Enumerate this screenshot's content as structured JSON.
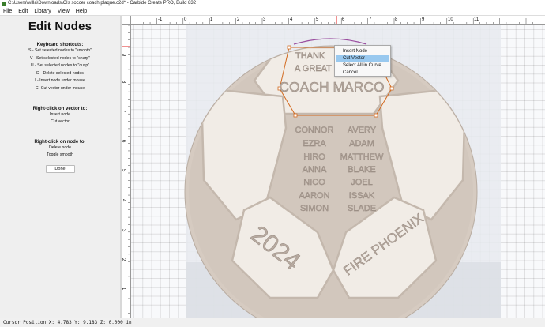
{
  "window": {
    "title": "C:\\Users\\willa\\Downloads\\CIs soccer coach plaque.c2d* - Carbide Create PRO, Build 832"
  },
  "menu": [
    "File",
    "Edit",
    "Library",
    "View",
    "Help"
  ],
  "panel": {
    "title": "Edit Nodes",
    "keyboard_heading": "Keyboard shortcuts:",
    "keyboard_lines": [
      "S - Set selected nodes to \"smooth\"",
      "V - Set selected nodes to \"sharp\"",
      "U - Set selected nodes to \"cusp\"",
      "D - Delete selected nodes",
      "I - Insert node under mouse",
      "C- Cut vector under mouse"
    ],
    "vector_heading": "Right-click on vector to:",
    "vector_lines": [
      "Insert node",
      "Cut vector"
    ],
    "node_heading": "Right-click on node to:",
    "node_lines": [
      "Delete node",
      "Toggle smooth"
    ],
    "done_label": "Done"
  },
  "ruler_top": {
    "labels": [
      "-1",
      "0",
      "1",
      "2",
      "3",
      "4",
      "5",
      "6",
      "7",
      "8",
      "9",
      "10",
      "11"
    ]
  },
  "ruler_left": {
    "labels": [
      "9",
      "8",
      "7",
      "6",
      "5",
      "4",
      "3",
      "2",
      "1"
    ]
  },
  "design": {
    "line1": "THANK",
    "line2": "A GREAT",
    "coach": "COACH MARCO",
    "names_left": [
      "CONNOR",
      "EZRA",
      "HIRO",
      "ANNA",
      "NICO",
      "AARON",
      "SIMON"
    ],
    "names_right": [
      "AVERY",
      "ADAM",
      "MATTHEW",
      "BLAKE",
      "JOEL",
      "ISSAK",
      "SLADE"
    ],
    "year": "2024",
    "team": "FIRE PHOENIX"
  },
  "context_menu": {
    "items": [
      "Insert Node",
      "Cut Vector",
      "Select All in Curve",
      "Cancel"
    ],
    "selected_index": 1
  },
  "status": {
    "text": "Cursor Position X: 4.783 Y: 9.183 Z: 0.000 in"
  },
  "colors": {
    "accent_red": "#e02020",
    "selection_blue": "#99c9ef",
    "node_orange": "#d2691e",
    "wood": "#d2c7bd",
    "panel_face": "#f1ece6"
  }
}
